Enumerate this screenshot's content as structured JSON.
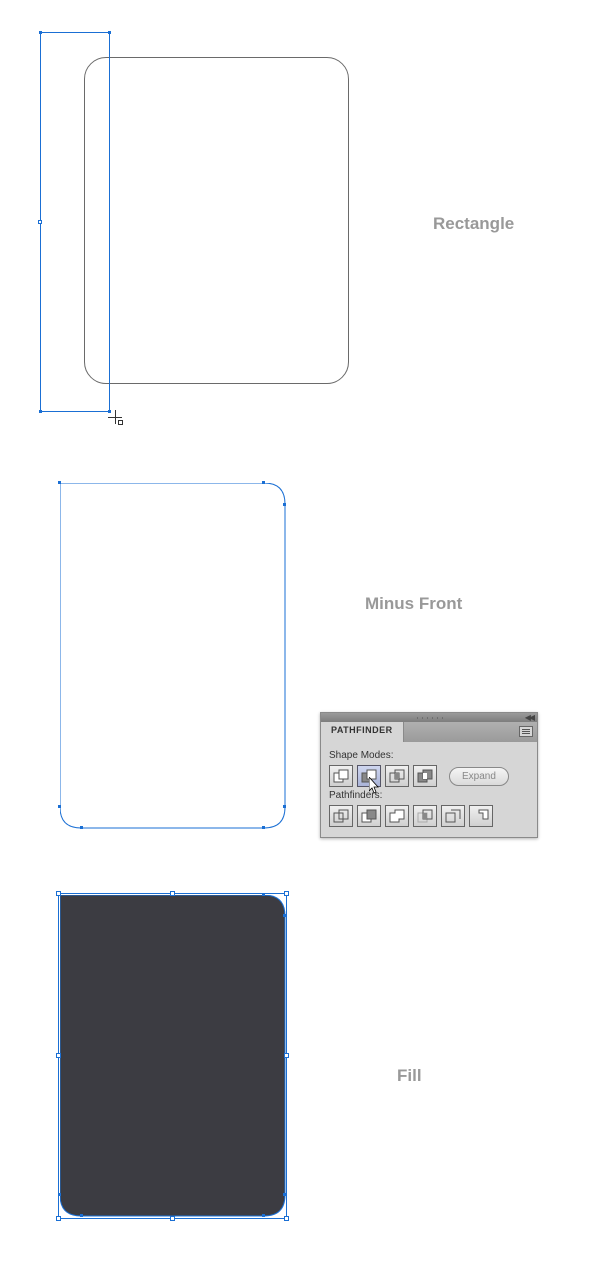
{
  "steps": {
    "rectangle_label": "Rectangle",
    "minus_front_label": "Minus Front",
    "fill_label": "Fill"
  },
  "pathfinder": {
    "title": "PATHFINDER",
    "shape_modes_label": "Shape Modes:",
    "pathfinders_label": "Pathfinders:",
    "expand_label": "Expand",
    "shape_mode_names": [
      "unite",
      "minus-front",
      "intersect",
      "exclude"
    ],
    "pathfinder_names": [
      "divide",
      "trim",
      "merge",
      "crop",
      "outline",
      "minus-back"
    ],
    "active_shape_mode": "minus-front"
  },
  "colors": {
    "selection": "#1a6fd4",
    "outline": "#6a6a6a",
    "fill_dark": "#3c3c42",
    "label_gray": "#999999"
  }
}
